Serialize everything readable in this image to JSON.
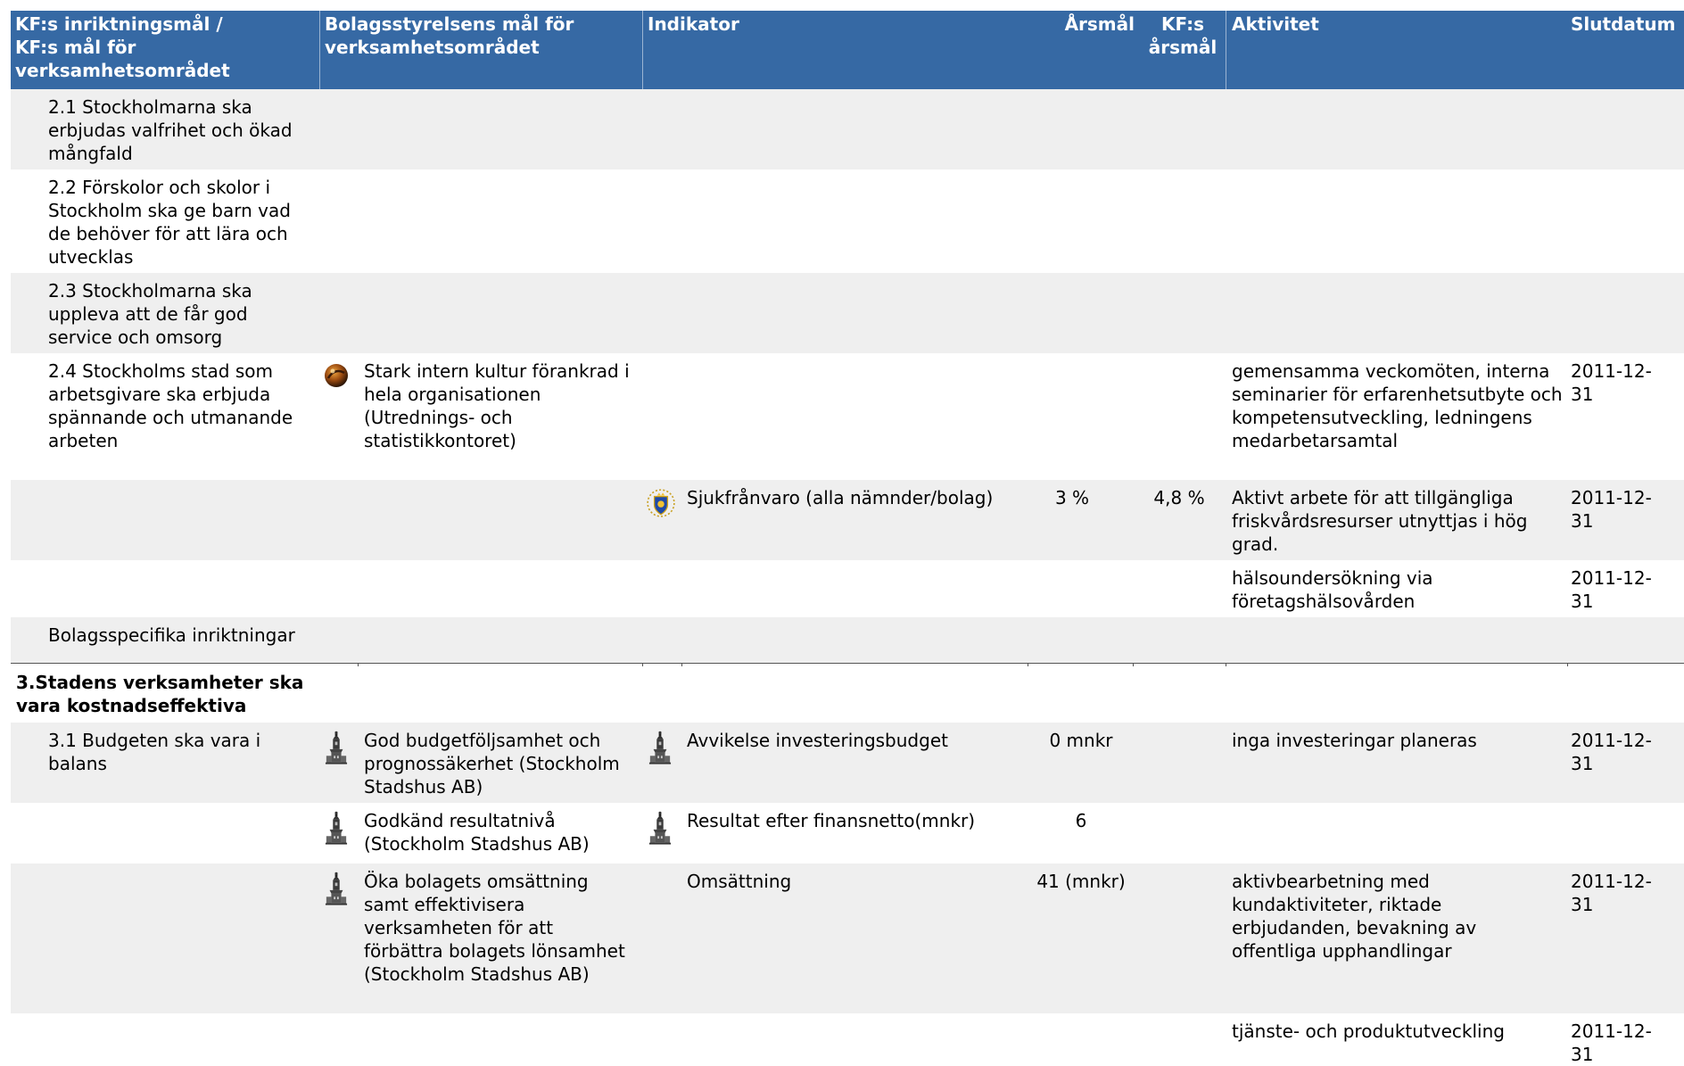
{
  "headers": {
    "col1": "KF:s inriktningsmål / KF:s mål för verksamhetsområdet",
    "col2": "Bolagsstyrelsens mål för verksamhetsområdet",
    "col3": "Indikator",
    "col4": "Årsmål",
    "col5": "KF:s årsmål",
    "col6": "Aktivitet",
    "col7": "Slutdatum"
  },
  "section2": {
    "rows": [
      {
        "goal": "2.1 Stockholmarna ska erbjudas valfrihet och ökad mångfald"
      },
      {
        "goal": "2.2 Förskolor och skolor i Stockholm ska ge barn vad de behöver för att lära och utvecklas"
      },
      {
        "goal": "2.3 Stockholmarna ska uppleva att de får god service och omsorg"
      },
      {
        "goal": "2.4 Stockholms stad som arbetsgivare ska erbjuda spännande och utmanande arbeten",
        "board_goal": "Stark intern kultur förankrad i hela organisationen (Utrednings- och statistikkontoret)",
        "board_icon": "orb-icon",
        "activity": "gemensamma veckomöten, interna seminarier för erfarenhetsutbyte och kompetensutveckling, ledningens medarbetarsamtal",
        "end_date": "2011-12-31"
      },
      {
        "indicator": "Sjukfrånvaro (alla nämnder/bolag)",
        "indicator_icon": "city-crest-icon",
        "year_target": "3 %",
        "kf_year_target": "4,8 %",
        "activity": "Aktivt arbete för att tillgängliga friskvårdsresurser utnyttjas i hög grad.",
        "end_date": "2011-12-31"
      },
      {
        "activity": "hälsoundersökning via företagshälsovården",
        "end_date": "2011-12-31"
      },
      {
        "goal": "Bolagsspecifika inriktningar"
      }
    ]
  },
  "section3": {
    "title": "3.Stadens verksamheter ska vara kostnadseffektiva",
    "rows": [
      {
        "goal": "3.1 Budgeten ska vara i balans",
        "board_goal": "God budgetföljsamhet och prognossäkerhet (Stockholm Stadshus AB)",
        "board_icon": "city-hall-tower-icon",
        "indicator": "Avvikelse investeringsbudget",
        "indicator_icon": "city-hall-tower-icon",
        "year_target": "0 mnkr",
        "activity": "inga investeringar planeras",
        "end_date": "2011-12-31"
      },
      {
        "board_goal": "Godkänd resultatnivå (Stockholm Stadshus AB)",
        "board_icon": "city-hall-tower-icon",
        "indicator": "Resultat efter finansnetto(mnkr)",
        "indicator_icon": "city-hall-tower-icon",
        "year_target": "6"
      },
      {
        "board_goal": "Öka bolagets omsättning samt effektivisera verksamheten för att förbättra bolagets lönsamhet (Stockholm Stadshus AB)",
        "board_icon": "city-hall-tower-icon",
        "indicator": "Omsättning",
        "year_target": "41 (mnkr)",
        "activity": "aktivbearbetning med kundaktiviteter, riktade erbjudanden, bevakning av offentliga upphandlingar",
        "end_date": "2011-12-31"
      },
      {
        "activity": "tjänste- och produktutveckling",
        "end_date": "2011-12-31"
      }
    ]
  }
}
